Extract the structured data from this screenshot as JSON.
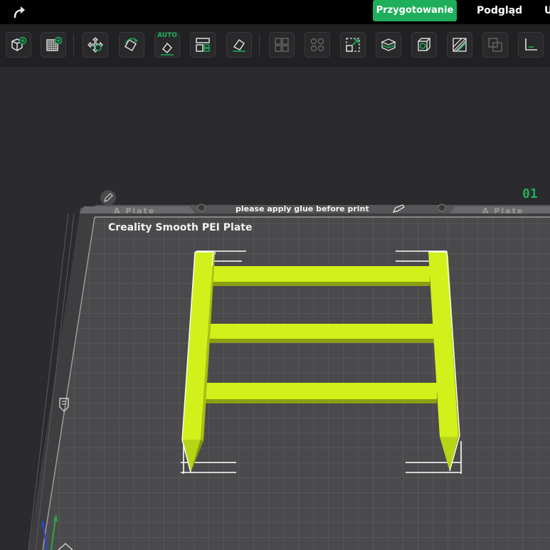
{
  "topbar": {
    "redo_icon": "redo-arrow-icon",
    "tabs": [
      {
        "label": "Przygotowanie",
        "active": true
      },
      {
        "label": "Podgląd",
        "active": false
      },
      {
        "label": "U",
        "active": false
      }
    ]
  },
  "toolbar": {
    "auto_label": "AUTO",
    "icons": [
      "add-cube-icon",
      "add-plate-icon",
      "move-icon",
      "rotate-icon",
      "auto-orient-icon",
      "arrange-icon",
      "lay-on-face-icon",
      "split-objects-icon",
      "split-parts-icon",
      "scale-icon",
      "cut-icon",
      "hollow-icon",
      "paint-icon",
      "boolean-icon",
      "measure-icon"
    ]
  },
  "plate": {
    "number": "01",
    "name": "Creality Smooth PEI Plate",
    "note": "please apply glue before print",
    "left_label": "A Plate",
    "right_label": "A Plate"
  },
  "colors": {
    "accent": "#1fae5b",
    "model": "#d2f01a",
    "bed": "#4a4a4c",
    "background": "#2b2b2d"
  }
}
